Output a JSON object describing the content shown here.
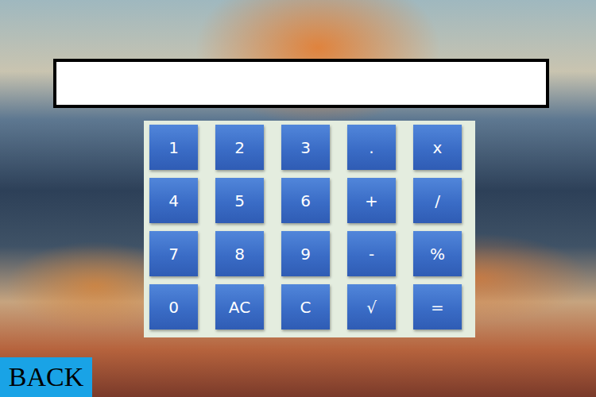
{
  "keys": [
    "1",
    "2",
    "3",
    ".",
    "x",
    "4",
    "5",
    "6",
    "+",
    "/",
    "7",
    "8",
    "9",
    "-",
    "%",
    "0",
    "AC",
    "C",
    "√",
    "="
  ],
  "back_button": "BACK"
}
